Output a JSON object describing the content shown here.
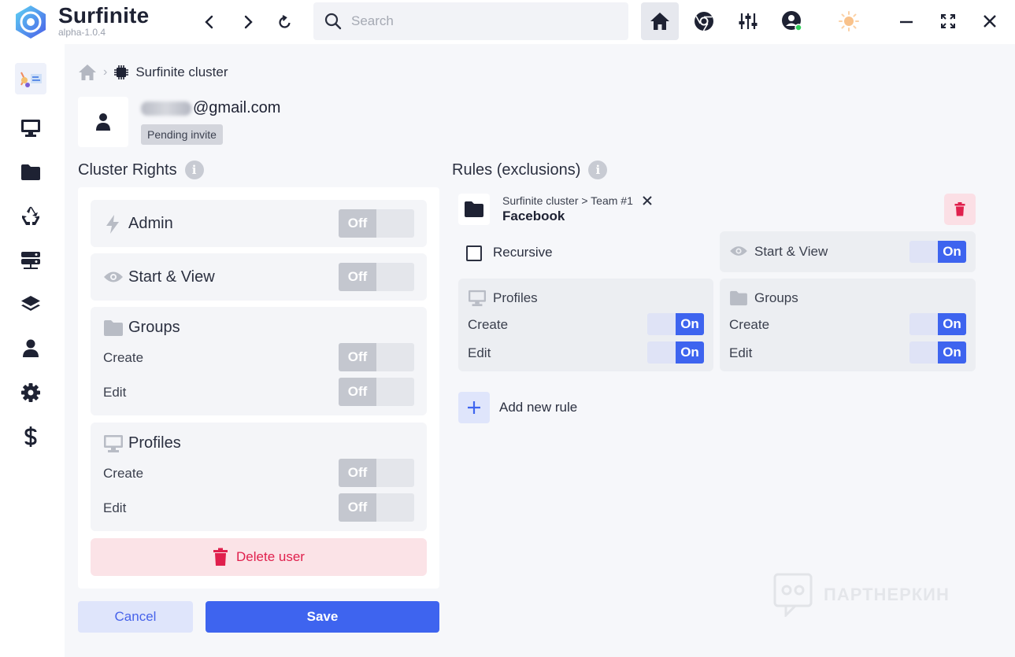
{
  "app": {
    "name": "Surfinite",
    "version": "alpha-1.0.4"
  },
  "search": {
    "placeholder": "Search"
  },
  "breadcrumb": {
    "label": "Surfinite cluster"
  },
  "user": {
    "email_suffix": "@gmail.com",
    "status_badge": "Pending invite"
  },
  "cluster_rights": {
    "title": "Cluster Rights",
    "admin": {
      "label": "Admin",
      "toggle": {
        "off": "Off",
        "on": "",
        "state": "off"
      }
    },
    "start_view": {
      "label": "Start & View",
      "toggle": {
        "off": "Off",
        "on": "",
        "state": "off"
      }
    },
    "groups": {
      "label": "Groups",
      "create": {
        "label": "Create",
        "toggle": {
          "off": "Off",
          "state": "off"
        }
      },
      "edit": {
        "label": "Edit",
        "toggle": {
          "off": "Off",
          "state": "off"
        }
      }
    },
    "profiles": {
      "label": "Profiles",
      "create": {
        "label": "Create",
        "toggle": {
          "off": "Off",
          "state": "off"
        }
      },
      "edit": {
        "label": "Edit",
        "toggle": {
          "off": "Off",
          "state": "off"
        }
      }
    },
    "delete_label": "Delete user"
  },
  "actions": {
    "cancel": "Cancel",
    "save": "Save"
  },
  "rules": {
    "title": "Rules (exclusions)",
    "rule": {
      "path": "Surfinite cluster > Team #1",
      "name": "Facebook",
      "recursive_label": "Recursive",
      "recursive_checked": false,
      "start_view": {
        "label": "Start & View",
        "toggle": {
          "on": "On",
          "state": "on"
        }
      },
      "profiles": {
        "label": "Profiles",
        "create": {
          "label": "Create",
          "toggle": {
            "on": "On",
            "state": "on"
          }
        },
        "edit": {
          "label": "Edit",
          "toggle": {
            "on": "On",
            "state": "on"
          }
        }
      },
      "groups": {
        "label": "Groups",
        "create": {
          "label": "Create",
          "toggle": {
            "on": "On",
            "state": "on"
          }
        },
        "edit": {
          "label": "Edit",
          "toggle": {
            "on": "On",
            "state": "on"
          }
        }
      }
    },
    "add_label": "Add new rule"
  },
  "watermark": "ПАРТНЕРКИН",
  "colors": {
    "accent": "#3e64ef",
    "danger": "#e0204d",
    "dark": "#222a3d"
  }
}
